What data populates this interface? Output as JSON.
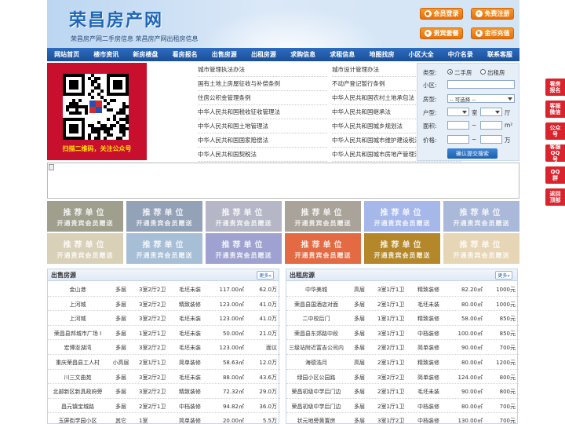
{
  "site": {
    "logo": "荣昌房产网",
    "subtitle": "荣昌房产网二手房信息    荣昌房产网出租房信息",
    "buttons": [
      {
        "label": "会员登录",
        "icon": "user-icon"
      },
      {
        "label": "免费注册",
        "icon": "register-icon"
      },
      {
        "label": "贵宾套餐",
        "icon": "vip-icon"
      },
      {
        "label": "金币充值",
        "icon": "coin-icon"
      }
    ]
  },
  "nav": [
    "网站首页",
    "楼市资讯",
    "新房楼盘",
    "看房报名",
    "出售房源",
    "出租房源",
    "求购信息",
    "求租信息",
    "地图找房",
    "小区大全",
    "中介名录",
    "联系客服"
  ],
  "qr": {
    "caption": "扫描二维码，关注公众号"
  },
  "laws": {
    "left": [
      "城市管理执法办法",
      "国有土地上房屋征收与补偿条例",
      "住房公积金管理条例",
      "中华人民共和国税收征收管理法",
      "中华人民共和国土地管理法",
      "中华人民共和国国家赔偿法",
      "中华人民共和国契税法"
    ],
    "right": [
      "城市设计管理办法",
      "不动产登记暂行条例",
      "中华人民共和国农村土地承包法",
      "中华人民共和国继承法",
      "中华人民共和国城乡规划法",
      "中华人民共和国城市维护建设税法",
      "中华人民共和国城市房地产管理法"
    ]
  },
  "search": {
    "type_label": "类型:",
    "type_options": [
      "二手房",
      "出租房"
    ],
    "community_label": "小区:",
    "room_label": "房型:",
    "room_value": "-- 可选择 --",
    "layout_label": "户型:",
    "layout_unit1": "室",
    "layout_unit2": "厅",
    "area_label": "面积:",
    "area_unit": "m²",
    "price_label": "价格:",
    "price_unit": "万",
    "tilde": "~",
    "submit": "确认提交搜索"
  },
  "recommend": {
    "title": "推荐单位",
    "sub": "开通贵宾会员赠送",
    "colors": [
      "#a09f8d",
      "#93a2b7",
      "#b5b7c6",
      "#a9a39a",
      "#a6b8ea",
      "#aab9d9",
      "#3e9aa8",
      "#d9d0b8",
      "#a6bed6",
      "#9fa2d0",
      "#e36a42",
      "#b4882a",
      "#e6d6b5"
    ]
  },
  "sale": {
    "title": "出售房源",
    "more": "更多»",
    "rows": [
      [
        "金山港",
        "多层",
        "3室2厅2卫",
        "毛坯未装",
        "117.00㎡",
        "62.0万"
      ],
      [
        "上河城",
        "多层",
        "3室2厅2卫",
        "精致装修",
        "123.00㎡",
        "41.0万"
      ],
      [
        "上河城",
        "多层",
        "3室2厅2卫",
        "毛坯未装",
        "123.00㎡",
        "41.0万"
      ],
      [
        "荣昌县邦城市广场 I",
        "多层",
        "1室2厅1卫",
        "毛坯未装",
        "50.00㎡",
        "21.0万"
      ],
      [
        "宏博澎湖湾",
        "多层",
        "3室2厅2卫",
        "毛坯未装",
        "123.00㎡",
        "面议"
      ],
      [
        "重庆荣昌县工人村",
        "小高层",
        "2室1厅1卫",
        "简单装修",
        "58.63㎡",
        "12.0万"
      ],
      [
        "川三文曲苑",
        "多层",
        "3室2厅2卫",
        "毛坯未装",
        "88.00㎡",
        "43.6万"
      ],
      [
        "北部新区新具政府旁",
        "多层",
        "3室2厅2卫",
        "精致装修",
        "72.32㎡",
        "29.0万"
      ],
      [
        "昌元镇宝城路",
        "多层",
        "2室2厅1卫",
        "中档装修",
        "94.82㎡",
        "36.0万"
      ],
      [
        "玉屏街学园小区",
        "其它",
        "1室",
        "简单装修",
        "20.00㎡",
        "5.5万"
      ]
    ]
  },
  "rent": {
    "title": "出租房源",
    "more": "更多»",
    "rows": [
      [
        "中华美城",
        "高层",
        "3室1厅1卫",
        "精致装修",
        "82.20㎡",
        "1000元"
      ],
      [
        "荣昌县国酒店对面",
        "多层",
        "2室1厅1卫",
        "毛坯未装",
        "80.00㎡",
        "1000元"
      ],
      [
        "二中校后门",
        "多层",
        "1室1厅1卫",
        "精致装修",
        "58.00㎡",
        "850元"
      ],
      [
        "荣昌县东郊路中段",
        "多层",
        "3室1厅1卫",
        "中档装修",
        "100.00㎡",
        "850元"
      ],
      [
        "三级站附近富吉公司内",
        "多层",
        "2室2厅1卫",
        "简单装修",
        "90.00㎡",
        "700元"
      ],
      [
        "海德浩月",
        "高层",
        "2室1厅1卫",
        "精致装修",
        "80.00㎡",
        "1200元"
      ],
      [
        "绿园小区公园路",
        "多层",
        "3室2厅2卫",
        "简单装修",
        "124.00㎡",
        "800元"
      ],
      [
        "荣昌初级中学后门边",
        "多层",
        "2室1厅1卫",
        "毛坯未装",
        "90.00㎡",
        "800元"
      ],
      [
        "荣昌初级中学后门边",
        "多层",
        "2室1厅1卫",
        "中档装修",
        "80.00㎡",
        "700元"
      ],
      [
        "状元地旁黄置房",
        "多层",
        "3室1厅2卫",
        "中档装修",
        "130.00㎡",
        "700元"
      ]
    ]
  },
  "side": [
    {
      "label": "看房报名",
      "icon": "signup-icon"
    },
    {
      "label": "客服微信",
      "icon": "wechat-icon"
    },
    {
      "label": "公众号",
      "icon": "official-account-icon"
    },
    {
      "label": "客服QQ号",
      "icon": "qq-icon"
    },
    {
      "label": "QQ群",
      "icon": "qq-group-icon"
    },
    {
      "label": "返回顶部",
      "icon": "back-to-top-icon"
    }
  ]
}
